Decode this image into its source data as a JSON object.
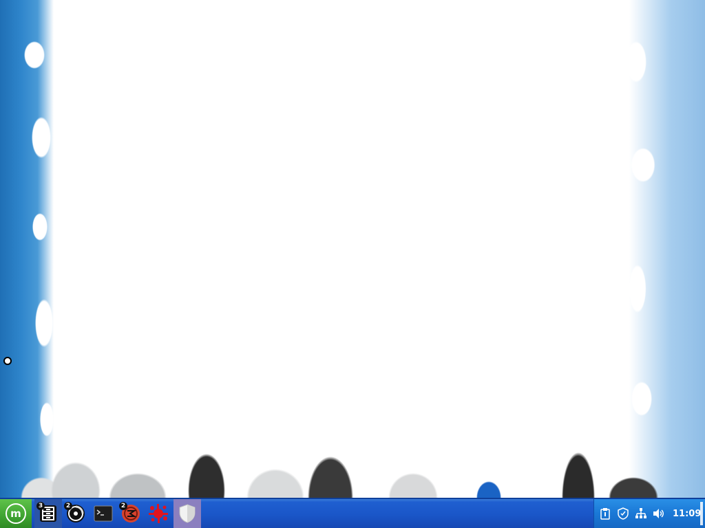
{
  "taskbar": {
    "menu_button_glyph": "m",
    "launchers": [
      {
        "name": "file-manager-icon",
        "badge": "3"
      },
      {
        "name": "cd-burner-icon",
        "badge": "2"
      },
      {
        "name": "terminal-icon",
        "badge": ""
      },
      {
        "name": "email-client-icon",
        "badge": "2"
      },
      {
        "name": "paint-splat-icon",
        "badge": ""
      },
      {
        "name": "shield-icon",
        "badge": ""
      }
    ],
    "tray": {
      "icons": [
        "clipboard-icon",
        "security-shield-icon",
        "network-icon",
        "volume-icon"
      ],
      "clock": "11:09"
    },
    "colors": {
      "bar": "#1a56c8",
      "menu_button": "#3ea330",
      "tray": "#1a78d6"
    }
  }
}
